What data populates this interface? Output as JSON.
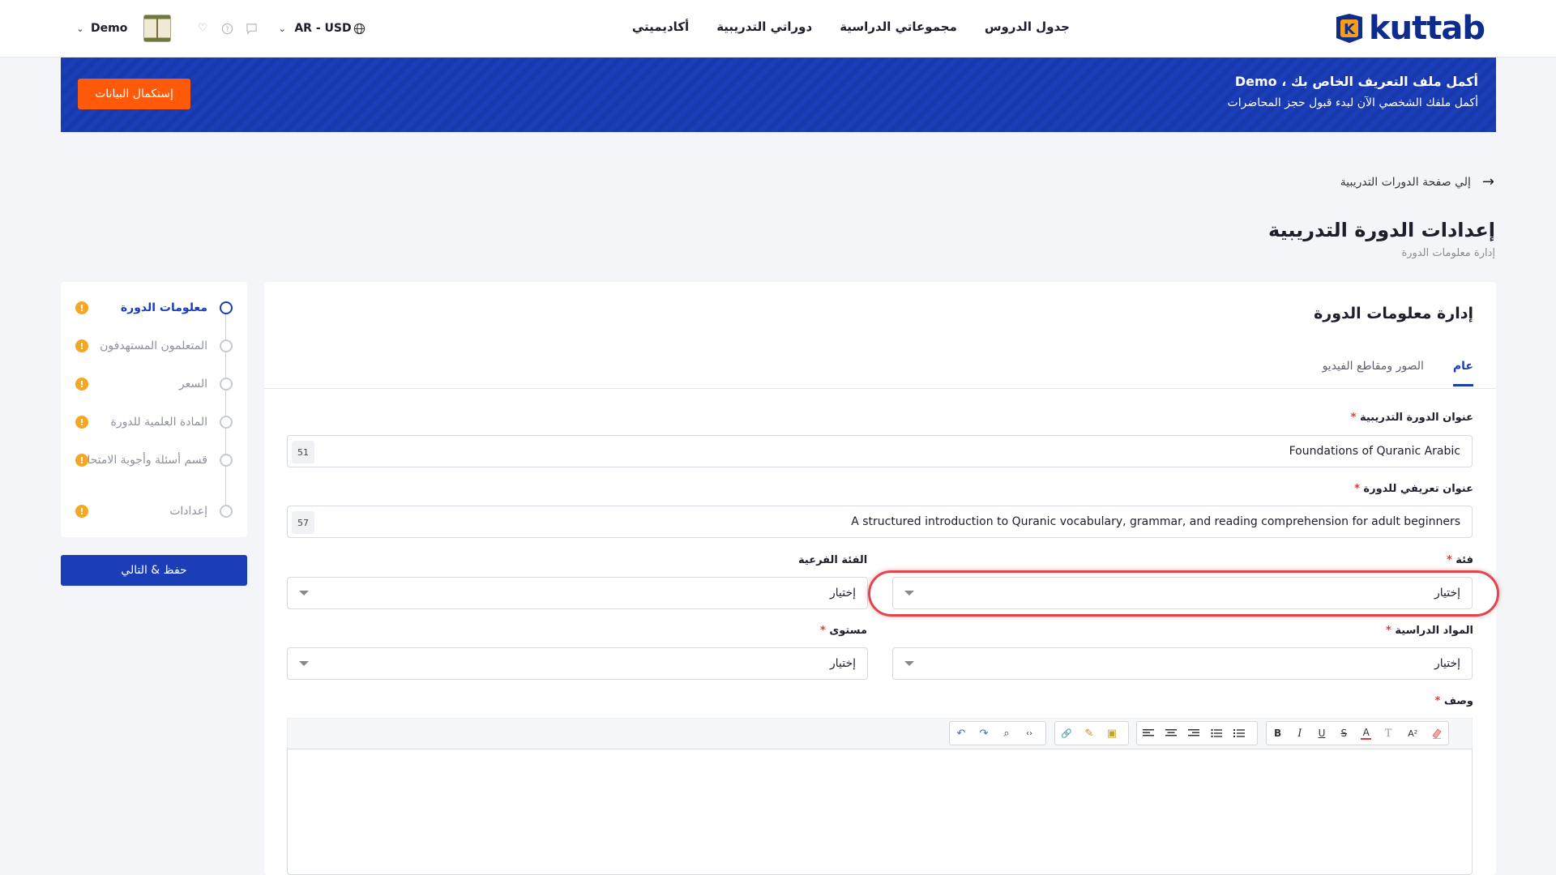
{
  "brand": {
    "name": "kuttab",
    "mark_letter": "K",
    "color": "#0d2c8c"
  },
  "nav": {
    "items": [
      "جدول الدروس",
      "مجموعاتي الدراسية",
      "دوراتي التدريبية",
      "أكاديميتي"
    ]
  },
  "user": {
    "name": "Demo",
    "language_currency": "AR - USD"
  },
  "banner": {
    "title": "أكمل ملف التعريف الخاص بك ، Demo",
    "subtitle": "أكمل ملفك الشخصي الآن لبدء قبول حجز المحاضرات",
    "button": "إستكمال البيانات"
  },
  "breadcrumb": {
    "back_label": "إلي صفحة الدورات التدريبية"
  },
  "page": {
    "title": "إعدادات الدورة التدريبية",
    "subtitle": "إدارة معلومات الدورة"
  },
  "steps": {
    "items": [
      {
        "label": "معلومات الدورة",
        "active": true
      },
      {
        "label": "المتعلمون المستهدفون",
        "active": false
      },
      {
        "label": "السعر",
        "active": false
      },
      {
        "label": "المادة العلمية للدورة",
        "active": false
      },
      {
        "label": "قسم أسئلة وأجوبة الامتحان",
        "active": false
      },
      {
        "label": "إعدادات",
        "active": false
      }
    ],
    "warning_glyph": "!",
    "save_button": "حفظ & التالي"
  },
  "card": {
    "title": "إدارة معلومات الدورة",
    "tabs": [
      "عام",
      "الصور ومقاطع الفيديو"
    ]
  },
  "form": {
    "course_title": {
      "label": "عنوان الدورة التدريبية",
      "value": "Foundations of Quranic Arabic",
      "counter": "51"
    },
    "intro_title": {
      "label": "عنوان تعريفي للدورة",
      "value": "A structured introduction to Quranic vocabulary, grammar, and reading comprehension for adult beginners",
      "counter": "57"
    },
    "category": {
      "label": "فئة",
      "value": "إختيار"
    },
    "subcategory": {
      "label": "الفئة الفرعية",
      "value": "إختيار"
    },
    "subjects": {
      "label": "المواد الدراسية",
      "value": "إختيار"
    },
    "level": {
      "label": "مستوى",
      "value": "إختيار"
    },
    "description": {
      "label": "وصف"
    },
    "required_mark": "*"
  },
  "editor_toolbar": {
    "undo": "↶",
    "redo": "↷",
    "find": "⌕",
    "html": "‹›",
    "link": "🔗",
    "edit": "✎",
    "image": "▣",
    "bold": "B",
    "italic": "I",
    "underline": "U",
    "strike": "S",
    "fontcolor": "A",
    "clear": "T",
    "fontsize": "A²"
  },
  "colors": {
    "primary": "#1b3db8",
    "accent": "#ff5a0a",
    "warning": "#f5a623",
    "highlight": "#e0464c"
  }
}
